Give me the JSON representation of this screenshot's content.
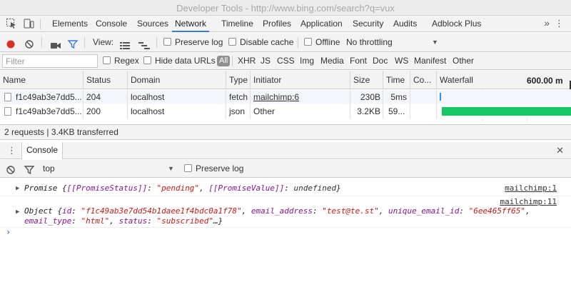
{
  "window": {
    "title": "Developer Tools - http://www.bing.com/search?q=vux"
  },
  "tabs": [
    "Elements",
    "Console",
    "Sources",
    "Network",
    "Timeline",
    "Profiles",
    "Application",
    "Security",
    "Audits",
    "Adblock Plus"
  ],
  "active_tab": "Network",
  "network_toolbar": {
    "view_label": "View:",
    "preserve_log": "Preserve log",
    "disable_cache": "Disable cache",
    "offline": "Offline",
    "throttling": "No throttling"
  },
  "filter": {
    "placeholder": "Filter",
    "regex": "Regex",
    "hide_data_urls": "Hide data URLs",
    "all": "All",
    "types": [
      "XHR",
      "JS",
      "CSS",
      "Img",
      "Media",
      "Font",
      "Doc",
      "WS",
      "Manifest",
      "Other"
    ]
  },
  "table": {
    "columns": [
      "Name",
      "Status",
      "Domain",
      "Type",
      "Initiator",
      "Size",
      "Time",
      "Co...",
      "Waterfall"
    ],
    "waterfall_scale": "600.00 m",
    "rows": [
      {
        "name": "f1c49ab3e7dd5...",
        "status": "204",
        "domain": "localhost",
        "type": "fetch",
        "initiator": "mailchimp:6",
        "size": "230B",
        "time": "5ms"
      },
      {
        "name": "f1c49ab3e7dd5...",
        "status": "200",
        "domain": "localhost",
        "type": "json",
        "initiator": "Other",
        "size": "3.2KB",
        "time": "59..."
      }
    ],
    "summary": "2 requests | 3.4KB transferred"
  },
  "drawer": {
    "tab": "Console",
    "context": "top",
    "preserve_log": "Preserve log"
  },
  "console": {
    "line1": {
      "prefix": "Promise {",
      "k1": "[[PromiseStatus]]",
      "sep1": ": ",
      "v1": "\"pending\"",
      "comma": ", ",
      "k2": "[[PromiseValue]]",
      "sep2": ": ",
      "v2": "undefined",
      "suffix": "}",
      "source": "mailchimp:1"
    },
    "line2": {
      "source": "mailchimp:11",
      "prefix": "Object {",
      "id_k": "id",
      "id_v": "\"f1c49ab3e7dd54b1daee1f4bdc0a1f78\"",
      "email_k": "email_address",
      "email_v": "\"test@te.st\"",
      "uid_k": "unique_email_id",
      "uid_v": "\"6ee465ff65\"",
      "type_k": "email_type",
      "type_v": "\"html\"",
      "status_k": "status",
      "status_v": "\"subscribed\"",
      "suffix": "…}"
    }
  },
  "colors": {
    "accent": "#3879d9",
    "record": "#d93025",
    "waterfall_short": "#2196f3",
    "waterfall_long": "#14c764"
  }
}
